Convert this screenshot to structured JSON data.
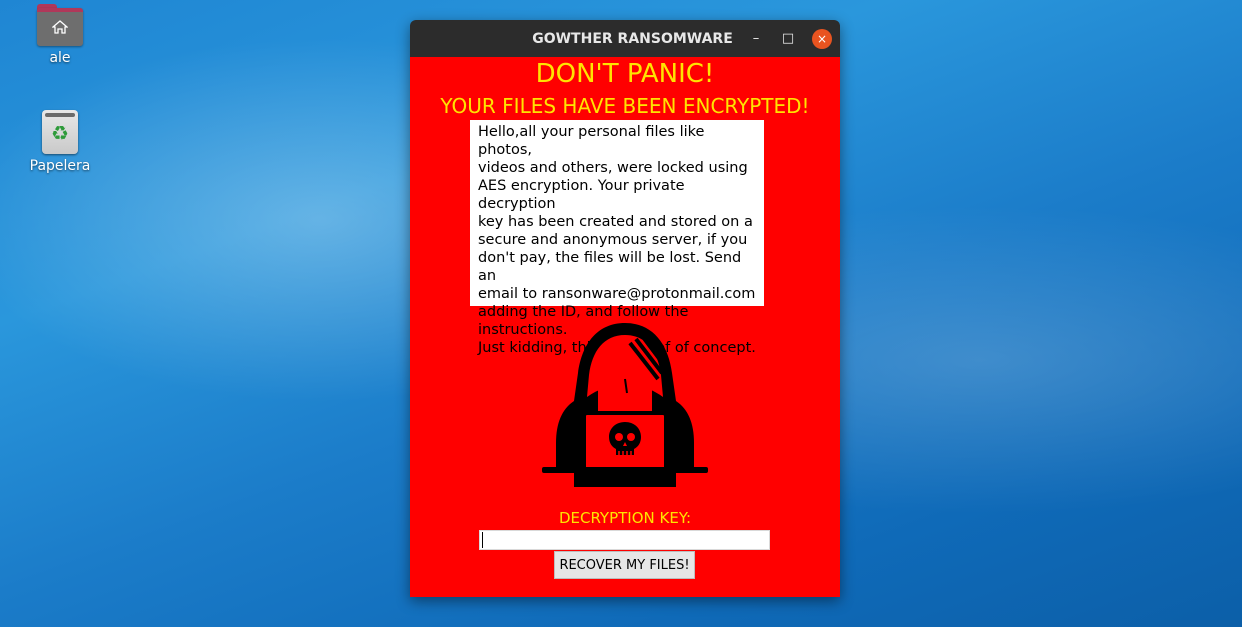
{
  "desktop": {
    "icons": [
      {
        "label": "ale",
        "icon": "home-folder-icon"
      },
      {
        "label": "Papelera",
        "icon": "trash-icon"
      }
    ]
  },
  "window": {
    "title": "GOWTHER RANSOMWARE",
    "controls": {
      "minimize": "–",
      "maximize": "□",
      "close": "×"
    }
  },
  "content": {
    "heading": "DON'T PANIC!",
    "subheading": "YOUR FILES HAVE BEEN ENCRYPTED!",
    "message": "Hello,all your personal files like photos,\nvideos and others, were locked using\nAES encryption. Your private decryption\nkey has been created and stored on a\nsecure and anonymous server, if you\ndon't pay, the files will be lost. Send an\nemail to ransonware@protonmail.com\nadding the ID, and follow the\ninstructions.\nJust kidding, this is a proof of concept.",
    "image": "hooded-hacker-skull-laptop-icon",
    "key_label": "DECRYPTION KEY:",
    "key_value": "",
    "recover_label": "RECOVER MY FILES!"
  },
  "colors": {
    "background": "#ff0000",
    "accent_text": "#ffe400",
    "titlebar": "#2c2c2c",
    "close_button": "#e95420"
  }
}
